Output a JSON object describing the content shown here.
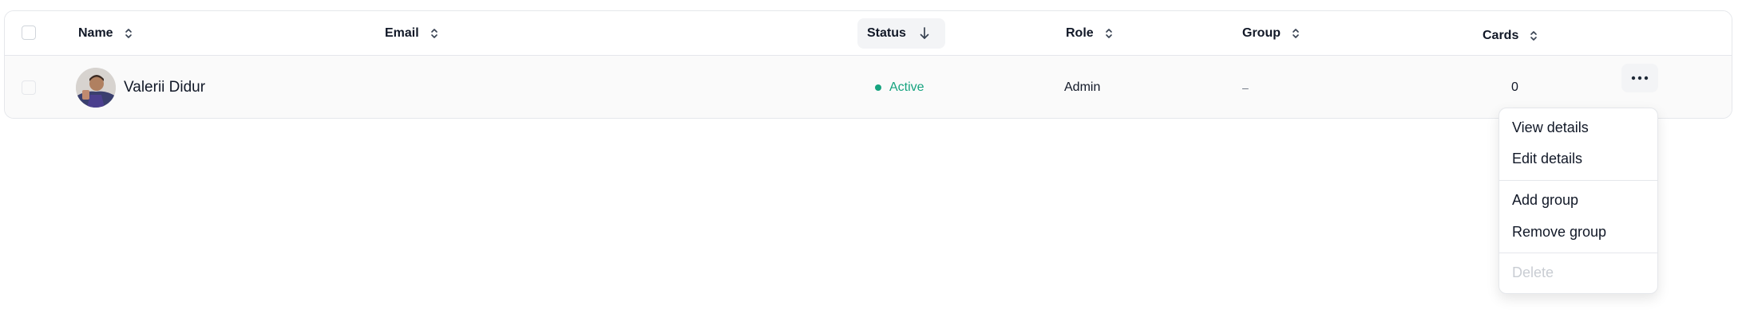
{
  "table": {
    "columns": {
      "name": "Name",
      "email": "Email",
      "status": "Status",
      "role": "Role",
      "group": "Group",
      "cards": "Cards"
    },
    "rows": [
      {
        "name": "Valerii Didur",
        "email": "",
        "status": "Active",
        "role": "Admin",
        "group": "–",
        "cards": "0"
      }
    ]
  },
  "row_menu": {
    "items": [
      {
        "label": "View details",
        "enabled": true
      },
      {
        "label": "Edit details",
        "enabled": true
      },
      {
        "label": "Add group",
        "enabled": true
      },
      {
        "label": "Remove group",
        "enabled": true
      },
      {
        "label": "Delete",
        "enabled": false
      }
    ]
  },
  "colors": {
    "status_active": "#16a37f",
    "border": "#e5e7eb",
    "disabled_text": "#c9cdd3"
  },
  "icons": {
    "sort": "sort-updown-icon",
    "sorted_desc": "arrow-down-icon",
    "more": "more-horizontal-icon"
  }
}
